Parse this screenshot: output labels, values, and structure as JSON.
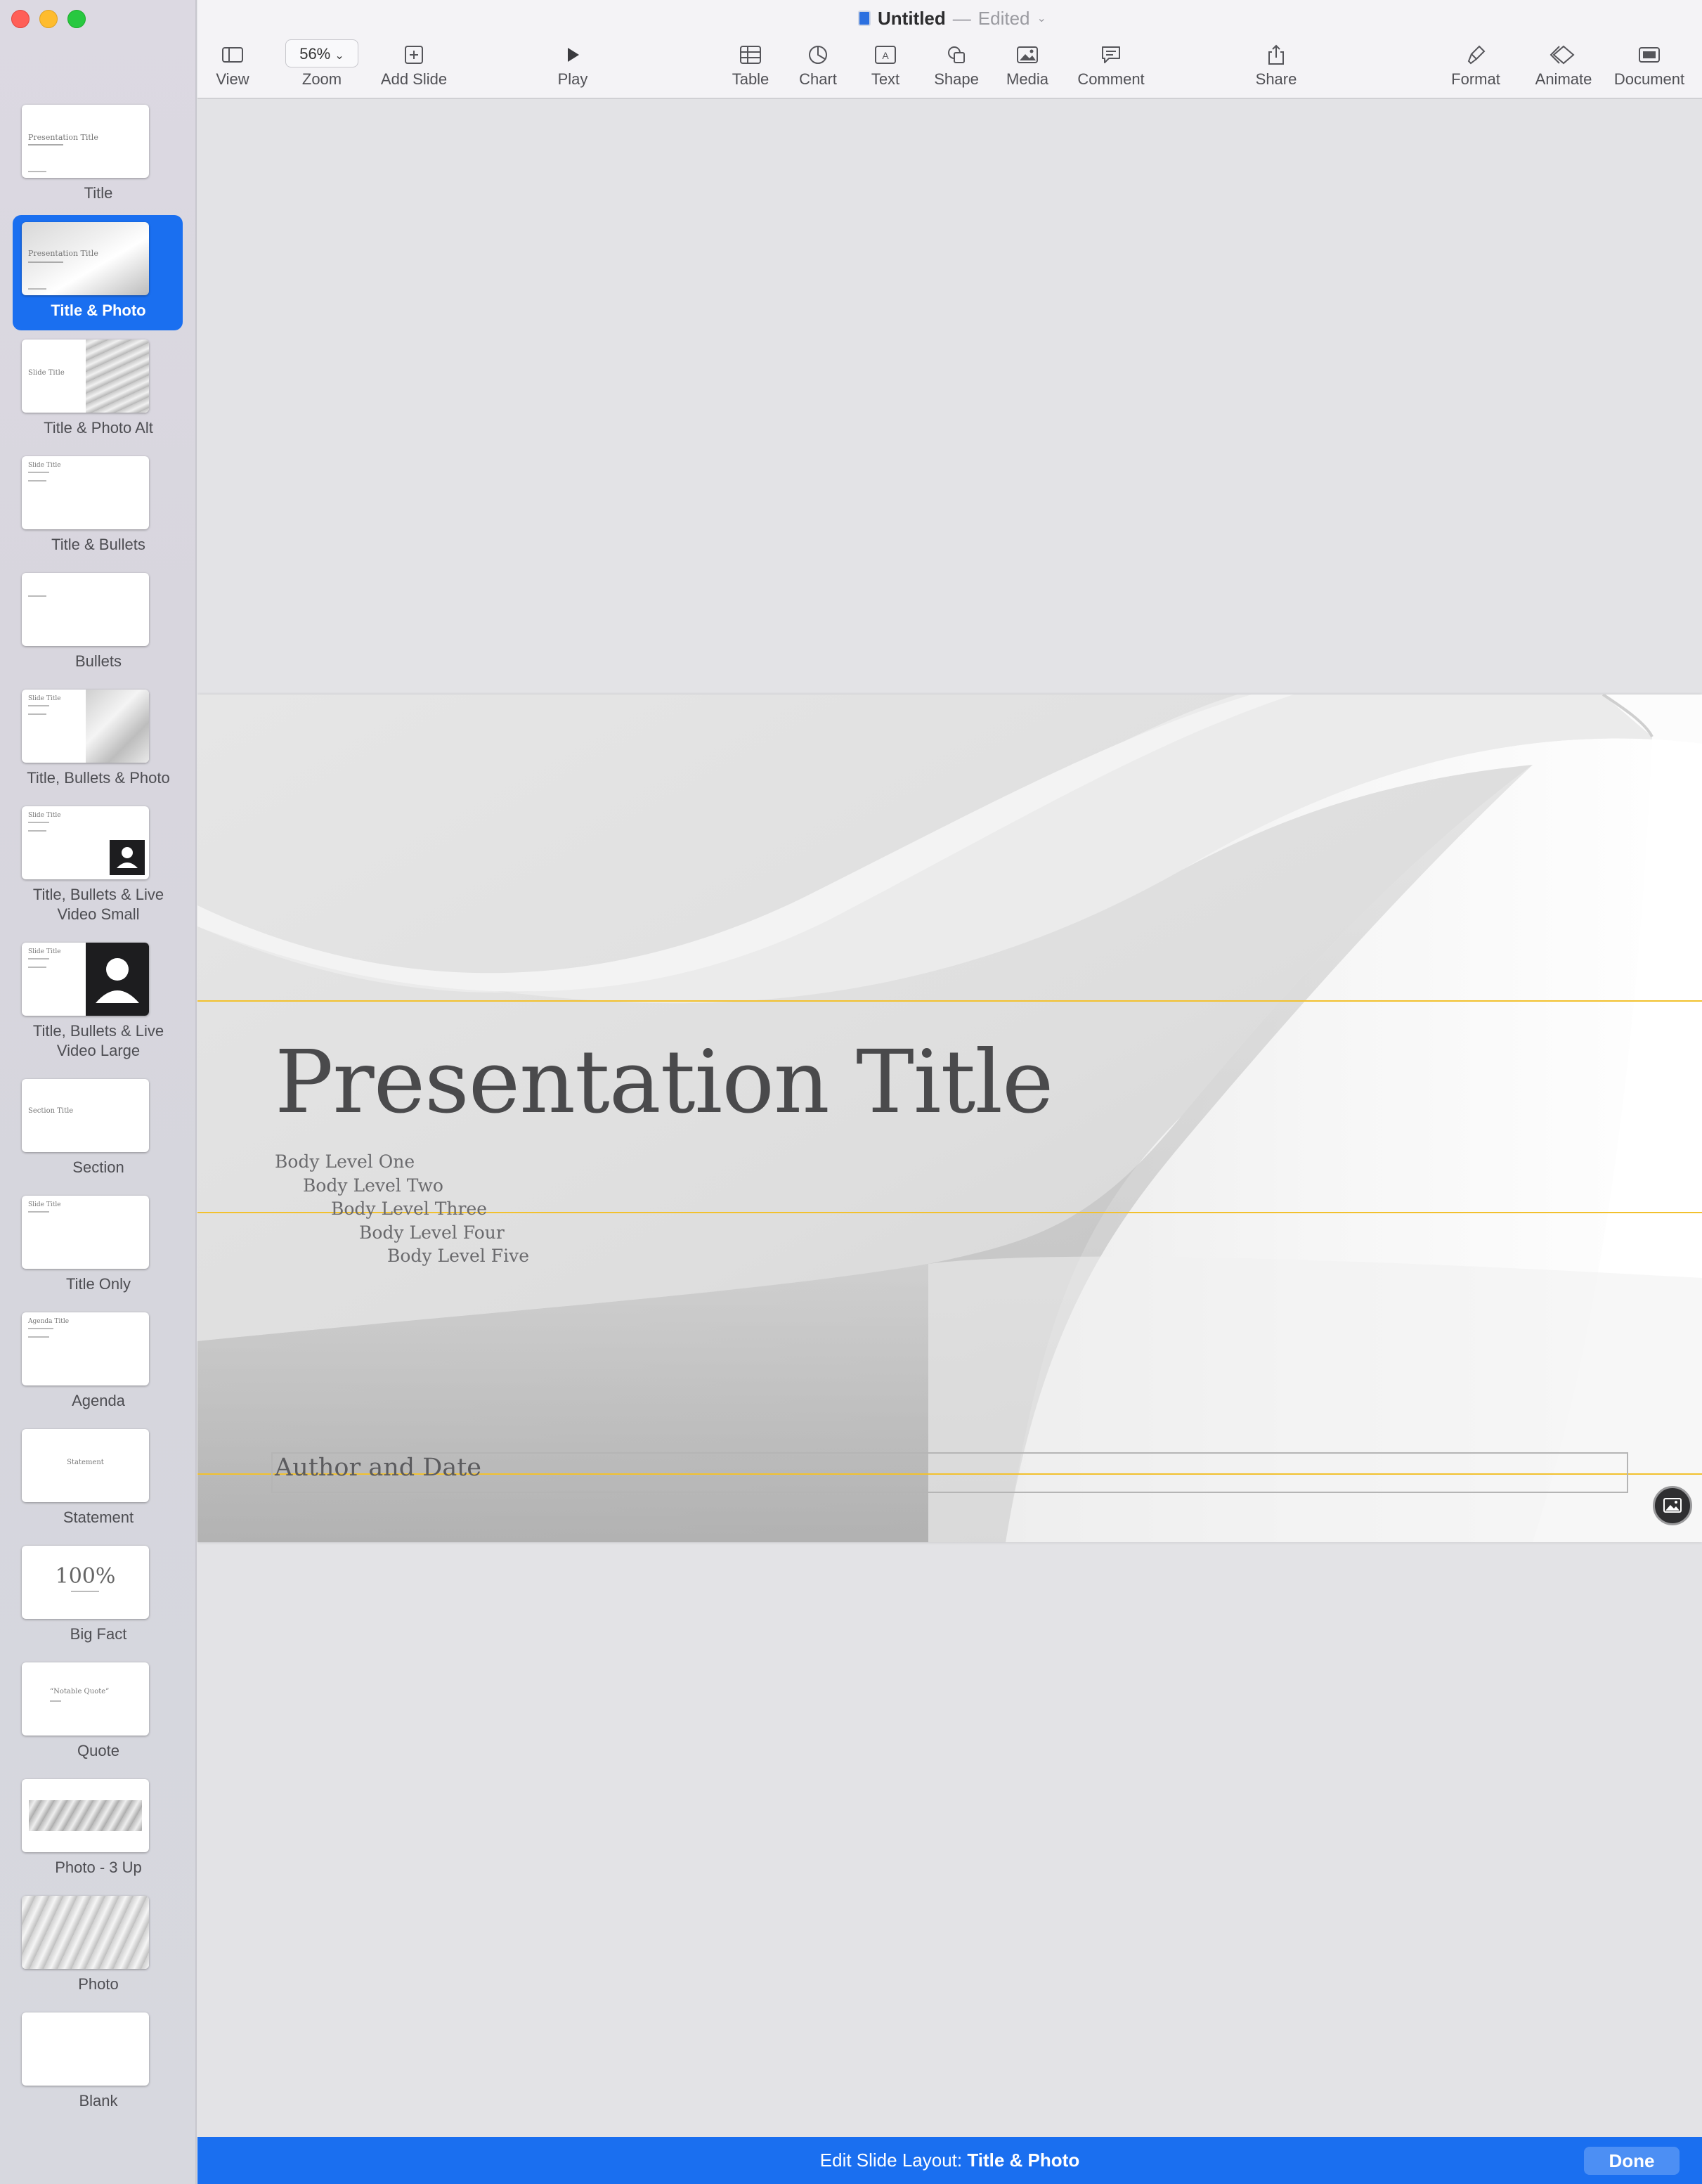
{
  "window": {
    "title": "Untitled",
    "title_separator": "—",
    "status": "Edited"
  },
  "toolbar": {
    "view": "View",
    "zoom_value": "56%",
    "zoom": "Zoom",
    "add_slide": "Add Slide",
    "play": "Play",
    "table": "Table",
    "chart": "Chart",
    "text": "Text",
    "shape": "Shape",
    "media": "Media",
    "comment": "Comment",
    "share": "Share",
    "format": "Format",
    "animate": "Animate",
    "document": "Document"
  },
  "sidebar": {
    "layouts": [
      {
        "label": "Title",
        "thumb_text": "Presentation Title"
      },
      {
        "label": "Title & Photo",
        "thumb_text": "Presentation Title",
        "selected": true
      },
      {
        "label": "Title & Photo Alt",
        "thumb_text": "Slide Title"
      },
      {
        "label": "Title & Bullets",
        "thumb_text": "Slide Title"
      },
      {
        "label": "Bullets",
        "thumb_text": ""
      },
      {
        "label": "Title, Bullets & Photo",
        "thumb_text": "Slide Title"
      },
      {
        "label": "Title, Bullets & Live",
        "label2": "Video Small",
        "thumb_text": "Slide Title"
      },
      {
        "label": "Title, Bullets & Live",
        "label2": "Video Large",
        "thumb_text": "Slide Title"
      },
      {
        "label": "Section",
        "thumb_text": "Section Title"
      },
      {
        "label": "Title Only",
        "thumb_text": "Slide Title"
      },
      {
        "label": "Agenda",
        "thumb_text": "Agenda Title"
      },
      {
        "label": "Statement",
        "thumb_text": "Statement"
      },
      {
        "label": "Big Fact",
        "thumb_text": "100%"
      },
      {
        "label": "Quote",
        "thumb_text": "“Notable Quote”"
      },
      {
        "label": "Photo - 3 Up",
        "thumb_text": ""
      },
      {
        "label": "Photo",
        "thumb_text": ""
      },
      {
        "label": "Blank",
        "thumb_text": ""
      }
    ]
  },
  "slide": {
    "title": "Presentation Title",
    "body": [
      "Body Level One",
      "Body Level Two",
      "Body Level Three",
      "Body Level Four",
      "Body Level Five"
    ],
    "author": "Author and Date"
  },
  "bottom_bar": {
    "prefix": "Edit Slide Layout:",
    "layout_name": "Title & Photo",
    "done": "Done"
  },
  "colors": {
    "accent": "#1a6ff0",
    "guide": "#f2c12e"
  }
}
